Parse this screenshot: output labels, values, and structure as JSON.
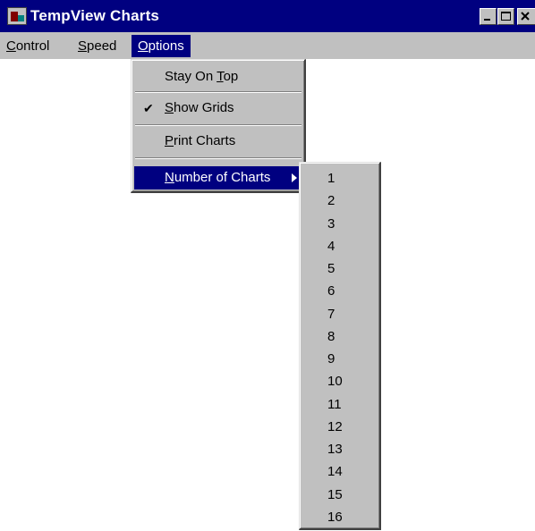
{
  "window": {
    "title": "TempView Charts",
    "icon": "app-chart-icon",
    "caption_buttons": [
      "minimize-icon",
      "maximize-icon",
      "close-icon"
    ]
  },
  "menubar": {
    "items": [
      {
        "label": "Control",
        "mnemonic": "C"
      },
      {
        "label": "Speed",
        "mnemonic": "S"
      },
      {
        "label": "Options",
        "mnemonic": "O",
        "active": true
      }
    ]
  },
  "options_menu": {
    "items": [
      {
        "label": "Stay On Top",
        "mnemonic": "T",
        "checked": false
      },
      {
        "label": "Show Grids",
        "mnemonic": "S",
        "checked": true
      },
      {
        "label": "Print Charts",
        "mnemonic": "P",
        "checked": false
      },
      {
        "label": "Number of Charts",
        "mnemonic": "N",
        "submenu": true,
        "highlighted": true
      }
    ],
    "check_glyph": "✔"
  },
  "charts_submenu": {
    "items": [
      "1",
      "2",
      "3",
      "4",
      "5",
      "6",
      "7",
      "8",
      "9",
      "10",
      "11",
      "12",
      "13",
      "14",
      "15",
      "16"
    ]
  },
  "colors": {
    "title_bar": "#000080",
    "menu_face": "#c0c0c0",
    "highlight": "#000080",
    "background": "#ffffff"
  }
}
